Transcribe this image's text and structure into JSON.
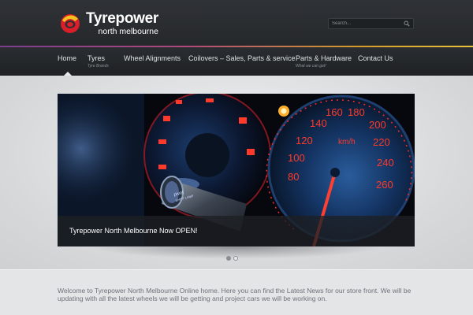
{
  "header": {
    "logo_title": "Tyrepower",
    "logo_subtitle": "north melbourne",
    "search_placeholder": "Search..."
  },
  "nav": {
    "items": [
      {
        "label": "Home",
        "sub": ""
      },
      {
        "label": "Tyres",
        "sub": "Tyre Brands"
      },
      {
        "label": "Wheel Alignments",
        "sub": ""
      },
      {
        "label": "Coilovers – Sales, Parts & service",
        "sub": ""
      },
      {
        "label": "Parts & Hardware",
        "sub": "What we can get!"
      },
      {
        "label": "Contact Us",
        "sub": ""
      }
    ]
  },
  "slider": {
    "caption": "Tyrepower North Melbourne Now OPEN!",
    "gauge_labels": [
      "160",
      "180",
      "140",
      "200",
      "120",
      "220",
      "100",
      "240",
      "80",
      "260",
      "km/h"
    ],
    "knob_text": "pivot",
    "knob_subtext": "SHIFT LAMP",
    "total_slides": 2,
    "active_slide": 1
  },
  "content": {
    "welcome_text": "Welcome to Tyrepower North Melbourne Online home. Here you can find the Latest News for our store front. We will be updating with all the latest wheels we will be getting and project cars we will be working on."
  },
  "colors": {
    "accent_red": "#ff3a2a",
    "logo_yellow": "#f4c21f",
    "logo_red": "#d81f2a"
  }
}
